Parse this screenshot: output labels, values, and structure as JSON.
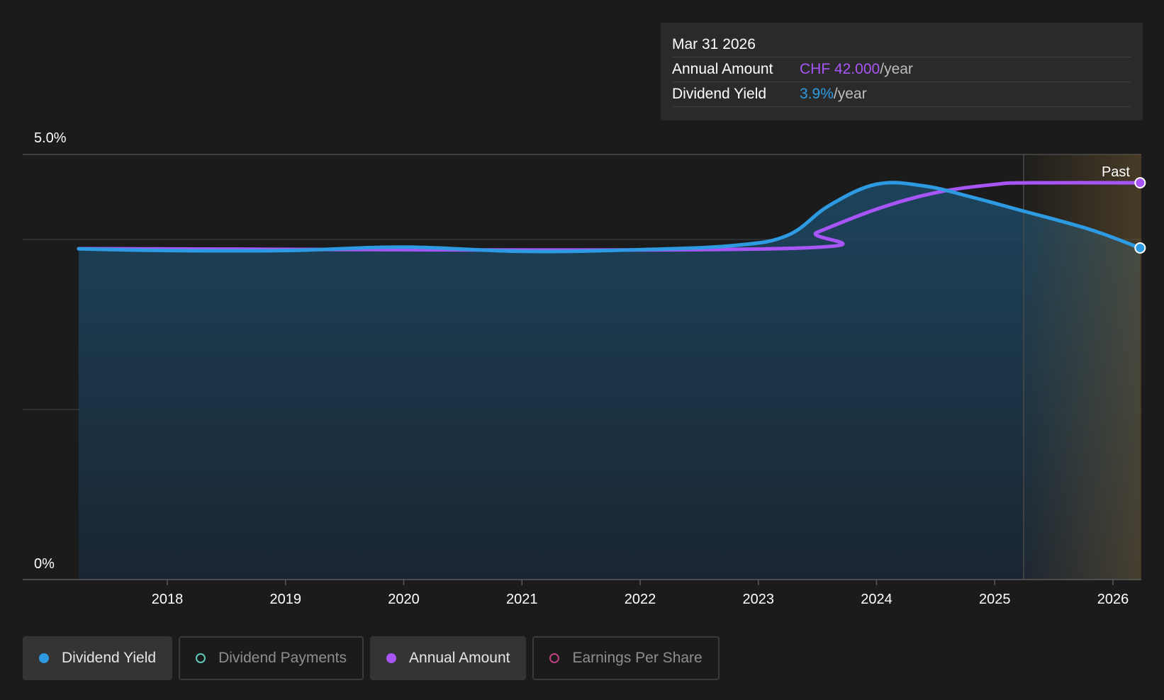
{
  "chart_data": {
    "type": "line",
    "x_ticks": [
      "2018",
      "2019",
      "2020",
      "2021",
      "2022",
      "2023",
      "2024",
      "2025",
      "2026"
    ],
    "y_ticks": [
      "0%",
      "5.0%"
    ],
    "ylim": [
      0,
      5.0
    ],
    "past_label": "Past",
    "series": [
      {
        "name": "Dividend Yield",
        "color": "#2d9ae2",
        "unit": "%",
        "points": [
          {
            "x": 2017.25,
            "y": 3.89
          },
          {
            "x": 2018.0,
            "y": 3.87
          },
          {
            "x": 2019.0,
            "y": 3.87
          },
          {
            "x": 2020.0,
            "y": 3.91
          },
          {
            "x": 2021.0,
            "y": 3.86
          },
          {
            "x": 2022.0,
            "y": 3.88
          },
          {
            "x": 2022.8,
            "y": 3.93
          },
          {
            "x": 2023.25,
            "y": 4.05
          },
          {
            "x": 2023.6,
            "y": 4.4
          },
          {
            "x": 2024.0,
            "y": 4.65
          },
          {
            "x": 2024.4,
            "y": 4.63
          },
          {
            "x": 2024.8,
            "y": 4.5
          },
          {
            "x": 2025.2,
            "y": 4.35
          },
          {
            "x": 2025.8,
            "y": 4.12
          },
          {
            "x": 2026.23,
            "y": 3.9
          }
        ]
      },
      {
        "name": "Annual Amount",
        "color": "#a855f7",
        "unit": "CHF",
        "points": [
          {
            "x": 2017.25,
            "y": 40.0
          },
          {
            "x": 2023.15,
            "y": 40.0
          },
          {
            "x": 2023.5,
            "y": 40.5
          },
          {
            "x": 2024.0,
            "y": 41.2
          },
          {
            "x": 2024.5,
            "y": 41.7
          },
          {
            "x": 2025.0,
            "y": 41.95
          },
          {
            "x": 2025.3,
            "y": 42.0
          },
          {
            "x": 2026.23,
            "y": 42.0
          }
        ]
      }
    ]
  },
  "tooltip": {
    "date": "Mar 31 2026",
    "rows": [
      {
        "label": "Annual Amount",
        "value": "CHF 42.000",
        "unit": "/year",
        "color": "#a855f7"
      },
      {
        "label": "Dividend Yield",
        "value": "3.9%",
        "unit": "/year",
        "color": "#2d9ae2"
      }
    ]
  },
  "legend": [
    {
      "label": "Dividend Yield",
      "color": "#2d9ae2",
      "active": true
    },
    {
      "label": "Dividend Payments",
      "color": "#5ec8b8",
      "active": false
    },
    {
      "label": "Annual Amount",
      "color": "#a855f7",
      "active": true
    },
    {
      "label": "Earnings Per Share",
      "color": "#c0407f",
      "active": false
    }
  ]
}
